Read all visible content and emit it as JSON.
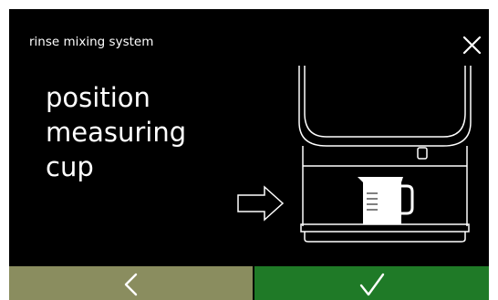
{
  "header": {
    "title": "rinse mixing system",
    "close_icon": "close-icon"
  },
  "main": {
    "instruction_lines": [
      "position",
      "measuring",
      "cup"
    ],
    "illustration": {
      "arrow_icon": "arrow-right-outline-icon",
      "machine": "coffee-machine-dispenser",
      "cup": "measuring-cup"
    }
  },
  "footer": {
    "back_icon": "chevron-left-icon",
    "confirm_icon": "checkmark-icon"
  },
  "colors": {
    "screen_background": "#000000",
    "back_button": "#8a8d5f",
    "confirm_button": "#1f7a27",
    "text": "#ffffff"
  }
}
